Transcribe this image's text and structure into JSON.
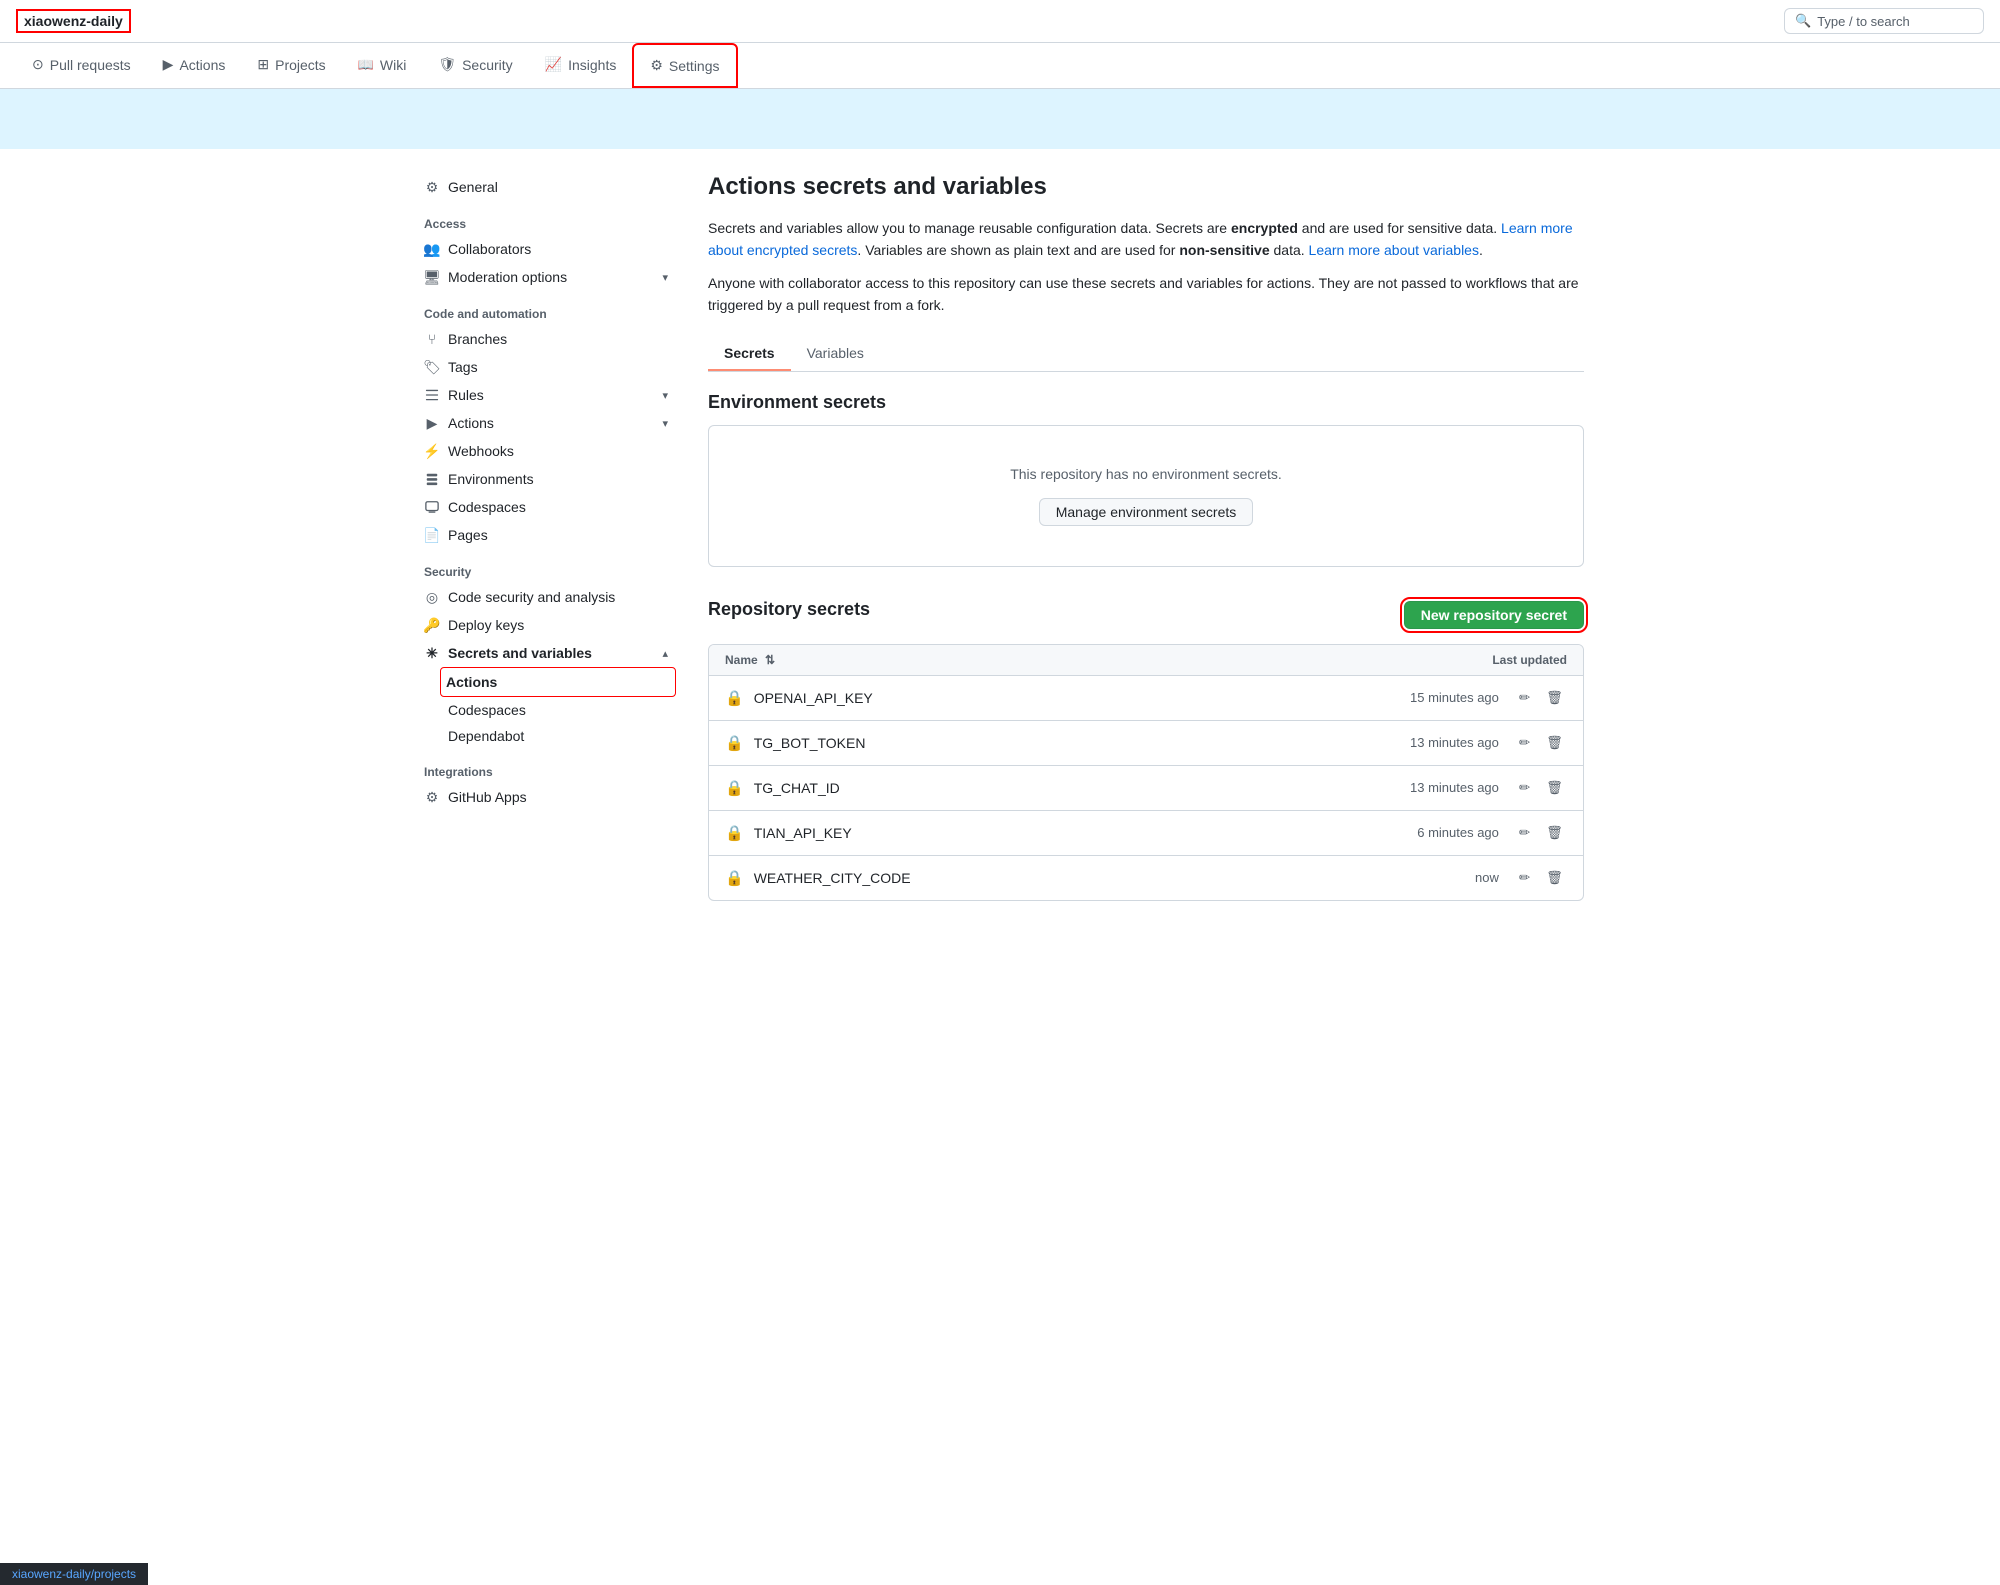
{
  "topbar": {
    "repo_name": "xiaowenz-daily",
    "search_placeholder": "Type / to search"
  },
  "nav": {
    "tabs": [
      {
        "id": "pull-requests",
        "label": "Pull requests",
        "icon": "⊙",
        "active": false
      },
      {
        "id": "actions",
        "label": "Actions",
        "icon": "▶",
        "active": false
      },
      {
        "id": "projects",
        "label": "Projects",
        "icon": "⊞",
        "active": false
      },
      {
        "id": "wiki",
        "label": "Wiki",
        "icon": "📖",
        "active": false
      },
      {
        "id": "security",
        "label": "Security",
        "icon": "🛡",
        "active": false
      },
      {
        "id": "insights",
        "label": "Insights",
        "icon": "📈",
        "active": false
      },
      {
        "id": "settings",
        "label": "Settings",
        "icon": "⚙",
        "active": true
      }
    ]
  },
  "sidebar": {
    "items_top": [
      {
        "id": "general",
        "label": "General",
        "icon": "⚙",
        "active": false
      }
    ],
    "access_section": "Access",
    "access_items": [
      {
        "id": "collaborators",
        "label": "Collaborators",
        "icon": "👥",
        "active": false
      },
      {
        "id": "moderation",
        "label": "Moderation options",
        "icon": "🖥",
        "active": false,
        "has_chevron": true
      }
    ],
    "code_automation_section": "Code and automation",
    "code_automation_items": [
      {
        "id": "branches",
        "label": "Branches",
        "icon": "⑂",
        "active": false
      },
      {
        "id": "tags",
        "label": "Tags",
        "icon": "🏷",
        "active": false
      },
      {
        "id": "rules",
        "label": "Rules",
        "icon": "⊞",
        "active": false,
        "has_chevron": true
      },
      {
        "id": "actions",
        "label": "Actions",
        "icon": "▶",
        "active": false,
        "has_chevron": true
      },
      {
        "id": "webhooks",
        "label": "Webhooks",
        "icon": "⚡",
        "active": false
      },
      {
        "id": "environments",
        "label": "Environments",
        "icon": "⊟",
        "active": false
      },
      {
        "id": "codespaces",
        "label": "Codespaces",
        "icon": "⊟",
        "active": false
      },
      {
        "id": "pages",
        "label": "Pages",
        "icon": "📄",
        "active": false
      }
    ],
    "security_section": "Security",
    "security_items": [
      {
        "id": "code-security",
        "label": "Code security and analysis",
        "icon": "◎",
        "active": false
      },
      {
        "id": "deploy-keys",
        "label": "Deploy keys",
        "icon": "🔑",
        "active": false
      },
      {
        "id": "secrets-variables",
        "label": "Secrets and variables",
        "icon": "*",
        "active": true,
        "has_chevron": true,
        "expanded": true
      }
    ],
    "secrets_sub_items": [
      {
        "id": "actions-sub",
        "label": "Actions",
        "active": true
      },
      {
        "id": "codespaces-sub",
        "label": "Codespaces",
        "active": false
      },
      {
        "id": "dependabot-sub",
        "label": "Dependabot",
        "active": false
      }
    ],
    "integrations_section": "Integrations",
    "integrations_items": [
      {
        "id": "github-apps",
        "label": "GitHub Apps",
        "icon": "⚙",
        "active": false
      }
    ]
  },
  "content": {
    "title": "Actions secrets and variables",
    "description1_before": "Secrets and variables allow you to manage reusable configuration data. Secrets are ",
    "description1_bold": "encrypted",
    "description1_after": " and are used for sensitive data. ",
    "link1_text": "Learn more about encrypted secrets",
    "description1_after2": ". Variables are shown as plain text and are used for ",
    "description1_bold2": "non-sensitive",
    "description1_after3": " data. ",
    "link2_text": "Learn more about variables",
    "description1_after4": ".",
    "description2": "Anyone with collaborator access to this repository can use these secrets and variables for actions. They are not passed to workflows that are triggered by a pull request from a fork.",
    "tabs": [
      {
        "id": "secrets",
        "label": "Secrets",
        "active": true
      },
      {
        "id": "variables",
        "label": "Variables",
        "active": false
      }
    ],
    "env_secrets_title": "Environment secrets",
    "env_secrets_empty": "This repository has no environment secrets.",
    "manage_env_btn": "Manage environment secrets",
    "repo_secrets_title": "Repository secrets",
    "new_secret_btn": "New repository secret",
    "table_col_name": "Name",
    "table_col_sort": "⇅",
    "table_col_updated": "Last updated",
    "secrets": [
      {
        "name": "OPENAI_API_KEY",
        "updated": "15 minutes ago"
      },
      {
        "name": "TG_BOT_TOKEN",
        "updated": "13 minutes ago"
      },
      {
        "name": "TG_CHAT_ID",
        "updated": "13 minutes ago"
      },
      {
        "name": "TIAN_API_KEY",
        "updated": "6 minutes ago"
      },
      {
        "name": "WEATHER_CITY_CODE",
        "updated": "now"
      }
    ]
  },
  "bottombar": {
    "path": "xiaowenz-daily/projects"
  }
}
